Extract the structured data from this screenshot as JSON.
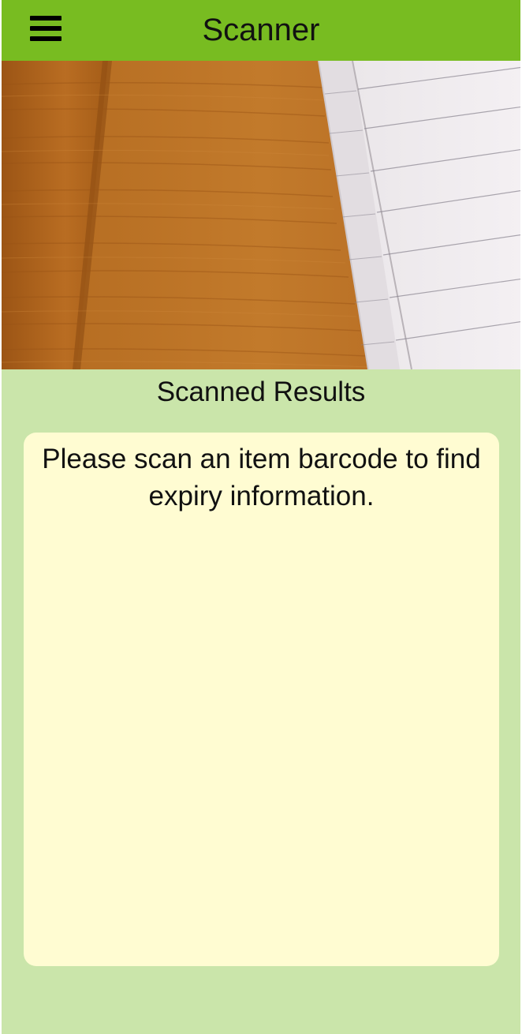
{
  "header": {
    "title": "Scanner",
    "menu_icon": "hamburger-menu-icon",
    "background": "#78bc21"
  },
  "camera": {
    "state": "live-preview"
  },
  "results": {
    "heading": "Scanned Results",
    "message": "Please scan an item barcode to find expiry information.",
    "card_background": "#fffcd2"
  },
  "colors": {
    "page_background": "#cae5aa"
  }
}
